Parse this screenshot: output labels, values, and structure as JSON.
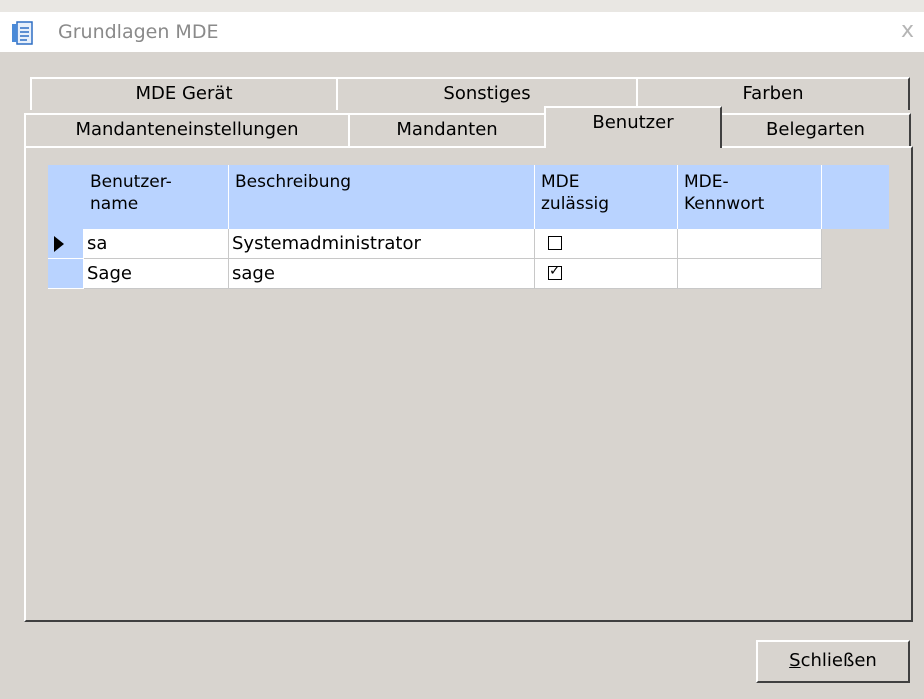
{
  "window": {
    "title": "Grundlagen MDE",
    "close_glyph": "x"
  },
  "tabs": {
    "row_back": [
      {
        "label": "MDE Gerät"
      },
      {
        "label": "Sonstiges"
      },
      {
        "label": "Farben"
      }
    ],
    "row_front": [
      {
        "label": "Mandanteneinstellungen"
      },
      {
        "label": "Mandanten"
      },
      {
        "label": "Benutzer",
        "active": true
      },
      {
        "label": "Belegarten"
      }
    ]
  },
  "grid": {
    "headers": [
      {
        "line1": "Benutzer-",
        "line2": "name"
      },
      {
        "line1": "Beschreibung",
        "line2": ""
      },
      {
        "line1": "MDE",
        "line2": "zulässig"
      },
      {
        "line1": "MDE-",
        "line2": "Kennwort"
      }
    ],
    "rows": [
      {
        "selected": true,
        "benutzername": "sa",
        "beschreibung": "Systemadministrator",
        "mde_zulaessig": false,
        "kennwort": ""
      },
      {
        "selected": false,
        "benutzername": "Sage",
        "beschreibung": "sage",
        "mde_zulaessig": true,
        "kennwort": ""
      }
    ],
    "row_indicator": "current-row-arrow-icon",
    "check_glyph": "✓"
  },
  "buttons": {
    "close_accel": "S",
    "close_rest": "chließen"
  },
  "colors": {
    "dialog_bg": "#d8d4cf",
    "grid_header": "#b9d3ff",
    "title_text": "#8a8a8a"
  }
}
